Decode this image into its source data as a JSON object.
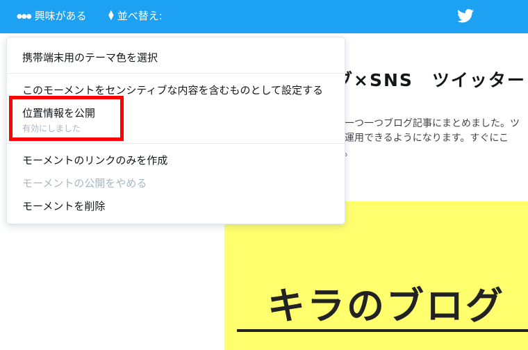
{
  "topbar": {
    "interest_label": "興味がある",
    "interest_icon": "more-dots-icon",
    "sort_label": "並べ替え:",
    "sort_icon": "sort-arrows-icon",
    "bird_icon": "twitter-bird-icon",
    "color": "#1da1f2"
  },
  "menu": {
    "theme_color": "携帯端末用のテーマ色を選択",
    "sensitive": "このモーメントをセンシティブな内容を含むものとして設定する",
    "location": "位置情報を公開",
    "location_status": "有効にしました",
    "link_only": "モーメントのリンクのみを作成",
    "unpublish": "モーメントの公開をやめる",
    "delete": "モーメントを削除"
  },
  "background": {
    "title": "ブ×SNS　ツイッター",
    "desc_lines": [
      "ー一つ一つブログ記事にまとめました。ツ",
      "く運用できるようになります。すぐにこ",
      "す。"
    ],
    "image_text": "キラのブログ"
  },
  "annotation": {
    "color": "#ff0000"
  }
}
